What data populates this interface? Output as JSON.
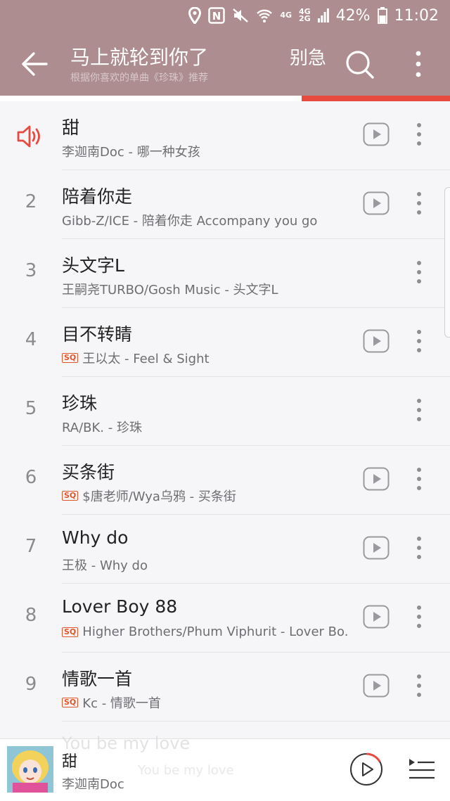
{
  "status_bar": {
    "nfc": "N",
    "net_top": "4G",
    "net_dual": "4G",
    "net_dual2": "2G",
    "battery": "42%",
    "time": "11:02",
    "icons": [
      "location-icon",
      "nfc-icon",
      "mute-icon",
      "wifi-icon",
      "signal-icon",
      "battery-icon"
    ]
  },
  "header": {
    "title": "马上就轮到你了",
    "subtitle": "根据你喜欢的单曲《珍珠》推荐",
    "title_next": "别急"
  },
  "accent_color": "#e84a3f",
  "header_color": "#ad8d8f",
  "playback_progress": 0.33,
  "songs": [
    {
      "num": "",
      "playing": true,
      "title": "甜",
      "meta": "李迦南Doc - 哪一种女孩",
      "sq": false,
      "mv": true
    },
    {
      "num": "2",
      "title": "陪着你走",
      "meta": "Gibb-Z/ICE - 陪着你走 Accompany you go",
      "sq": false,
      "mv": true
    },
    {
      "num": "3",
      "title": "头文字L",
      "meta": "王嗣尧TURBO/Gosh Music - 头文字L",
      "sq": false,
      "mv": false
    },
    {
      "num": "4",
      "title": "目不转睛",
      "meta": "王以太 - Feel & Sight",
      "sq": true,
      "mv": true
    },
    {
      "num": "5",
      "title": "珍珠",
      "meta": "RA/BK. - 珍珠",
      "sq": false,
      "mv": false
    },
    {
      "num": "6",
      "title": "买条街",
      "meta": "$唐老师/Wya乌鸦 - 买条街",
      "sq": true,
      "mv": true
    },
    {
      "num": "7",
      "title": "Why do",
      "meta": "王极 - Why do",
      "sq": false,
      "mv": true
    },
    {
      "num": "8",
      "title": "Lover Boy 88",
      "meta": "Higher Brothers/Phum Viphurit - Lover Bo...",
      "sq": true,
      "mv": true
    },
    {
      "num": "9",
      "title": "情歌一首",
      "meta": "Kc - 情歌一首",
      "sq": true,
      "mv": true
    }
  ],
  "sq_badge": "SQ",
  "mini_player": {
    "song": "甜",
    "artist": "李迦南Doc",
    "ghost_title": "You be my love",
    "ghost_meta": "You be my love"
  }
}
